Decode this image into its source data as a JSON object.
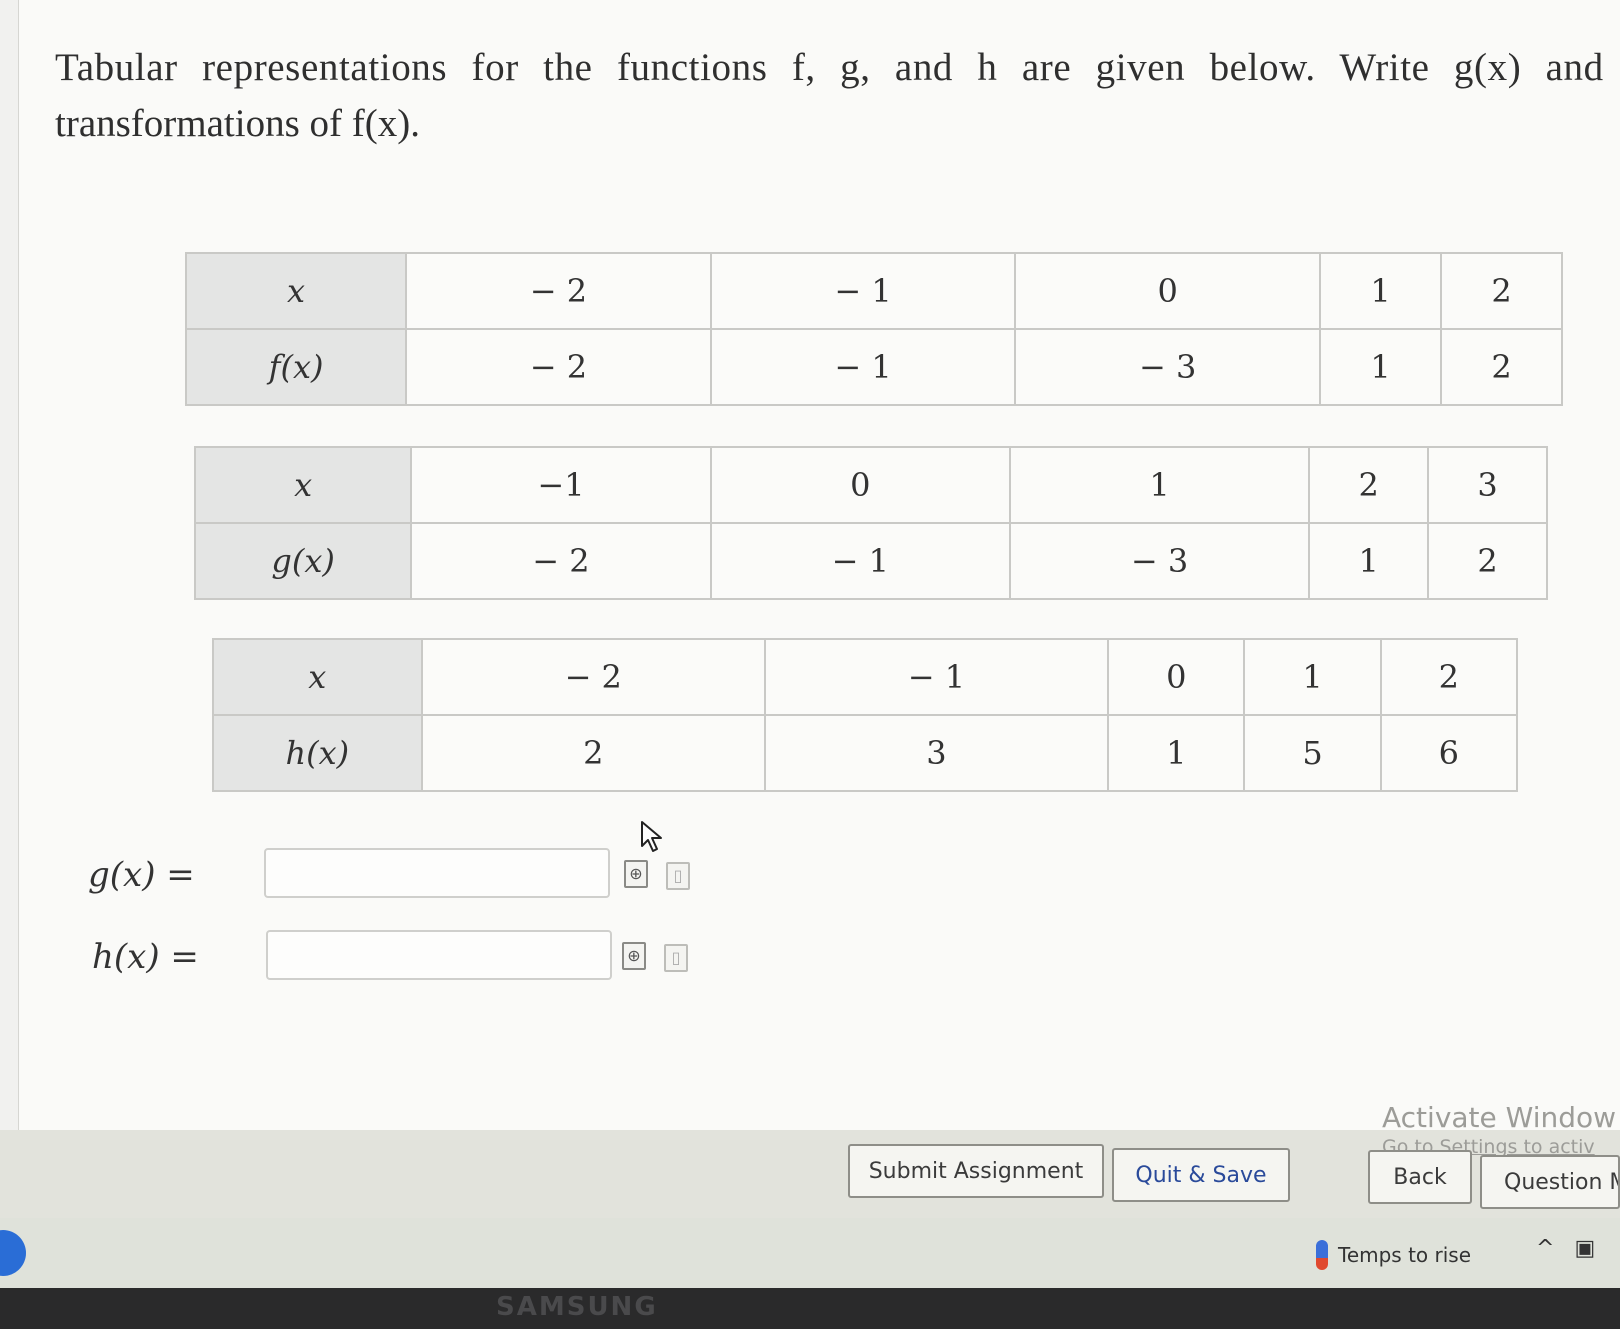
{
  "prompt": {
    "line1": "Tabular representations for the functions f, g, and h are given below. Write g(x) and h(x",
    "line2": "transformations of f(x)."
  },
  "tables": {
    "f": {
      "x_header": "x",
      "y_header": "f(x)",
      "x": [
        "− 2",
        "− 1",
        "0",
        "1",
        "2"
      ],
      "y": [
        "− 2",
        "− 1",
        "− 3",
        "1",
        "2"
      ]
    },
    "g": {
      "x_header": "x",
      "y_header": "g(x)",
      "x": [
        "−1",
        "0",
        "1",
        "2",
        "3"
      ],
      "y": [
        "− 2",
        "− 1",
        "− 3",
        "1",
        "2"
      ]
    },
    "h": {
      "x_header": "x",
      "y_header": "h(x)",
      "x": [
        "− 2",
        "− 1",
        "0",
        "1",
        "2"
      ],
      "y": [
        "2",
        "3",
        "1",
        "5",
        "6"
      ]
    }
  },
  "answers": {
    "g_label": "g(x)",
    "g_value": "",
    "h_label": "h(x)",
    "h_value": "",
    "equals": "="
  },
  "buttons": {
    "submit": "Submit Assignment",
    "quit": "Quit & Save",
    "back": "Back",
    "next": "Question M"
  },
  "watermark": {
    "title": "Activate Window",
    "subtitle": "Go to Settings to activ"
  },
  "taskbar": {
    "weather_text": "Temps to rise",
    "tray_chevron": "^"
  },
  "bezel": {
    "brand": "SAMSUNG"
  },
  "icons": [
    "preview-icon",
    "help-icon",
    "cursor-icon",
    "thermometer-icon",
    "chevron-up-icon",
    "tray-icon",
    "start-icon"
  ]
}
